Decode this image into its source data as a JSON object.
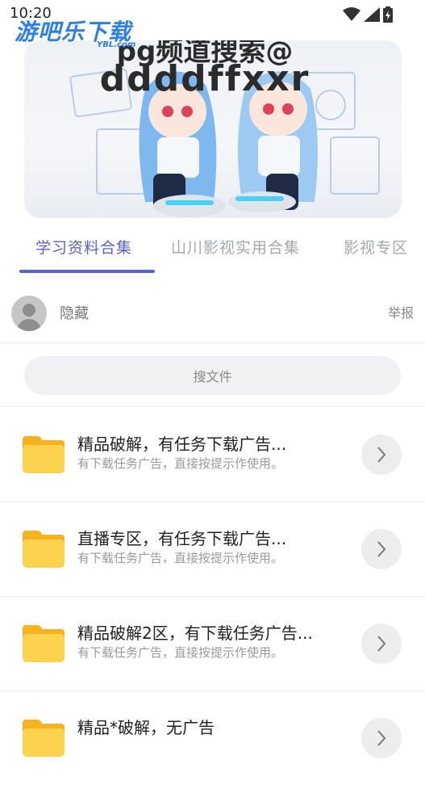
{
  "status_bar": {
    "time": "10:20"
  },
  "watermark": {
    "main": "游吧乐下载",
    "sub": "YBL.com"
  },
  "banner": {
    "line1": "pg频道搜索@",
    "line2": "ddddffxxr"
  },
  "tabs": [
    {
      "label": "学习资料合集",
      "active": true
    },
    {
      "label": "山川影视实用合集",
      "active": false
    },
    {
      "label": "影视专区",
      "active": false
    }
  ],
  "user": {
    "name": "隐藏",
    "report_label": "举报"
  },
  "search": {
    "placeholder": "搜文件"
  },
  "files": [
    {
      "title": "精品破解，有任务下载广告...",
      "subtitle": "有下载任务广告，直接按提示作使用。"
    },
    {
      "title": "直播专区，有任务下载广告...",
      "subtitle": "有下载任务广告，直接按提示作使用。"
    },
    {
      "title": "精品破解2区，有下载任务广告...",
      "subtitle": "有下载任务广告，直接按提示作使用。"
    },
    {
      "title": "精品*破解，无广告",
      "subtitle": ""
    }
  ],
  "colors": {
    "accent": "#5a62c8",
    "folder": "#fdd24e",
    "watermark": "#2a7fe8"
  },
  "icons": [
    "wifi-icon",
    "cell-signal-icon",
    "battery-icon",
    "folder-icon",
    "chevron-right-icon",
    "avatar-icon"
  ]
}
